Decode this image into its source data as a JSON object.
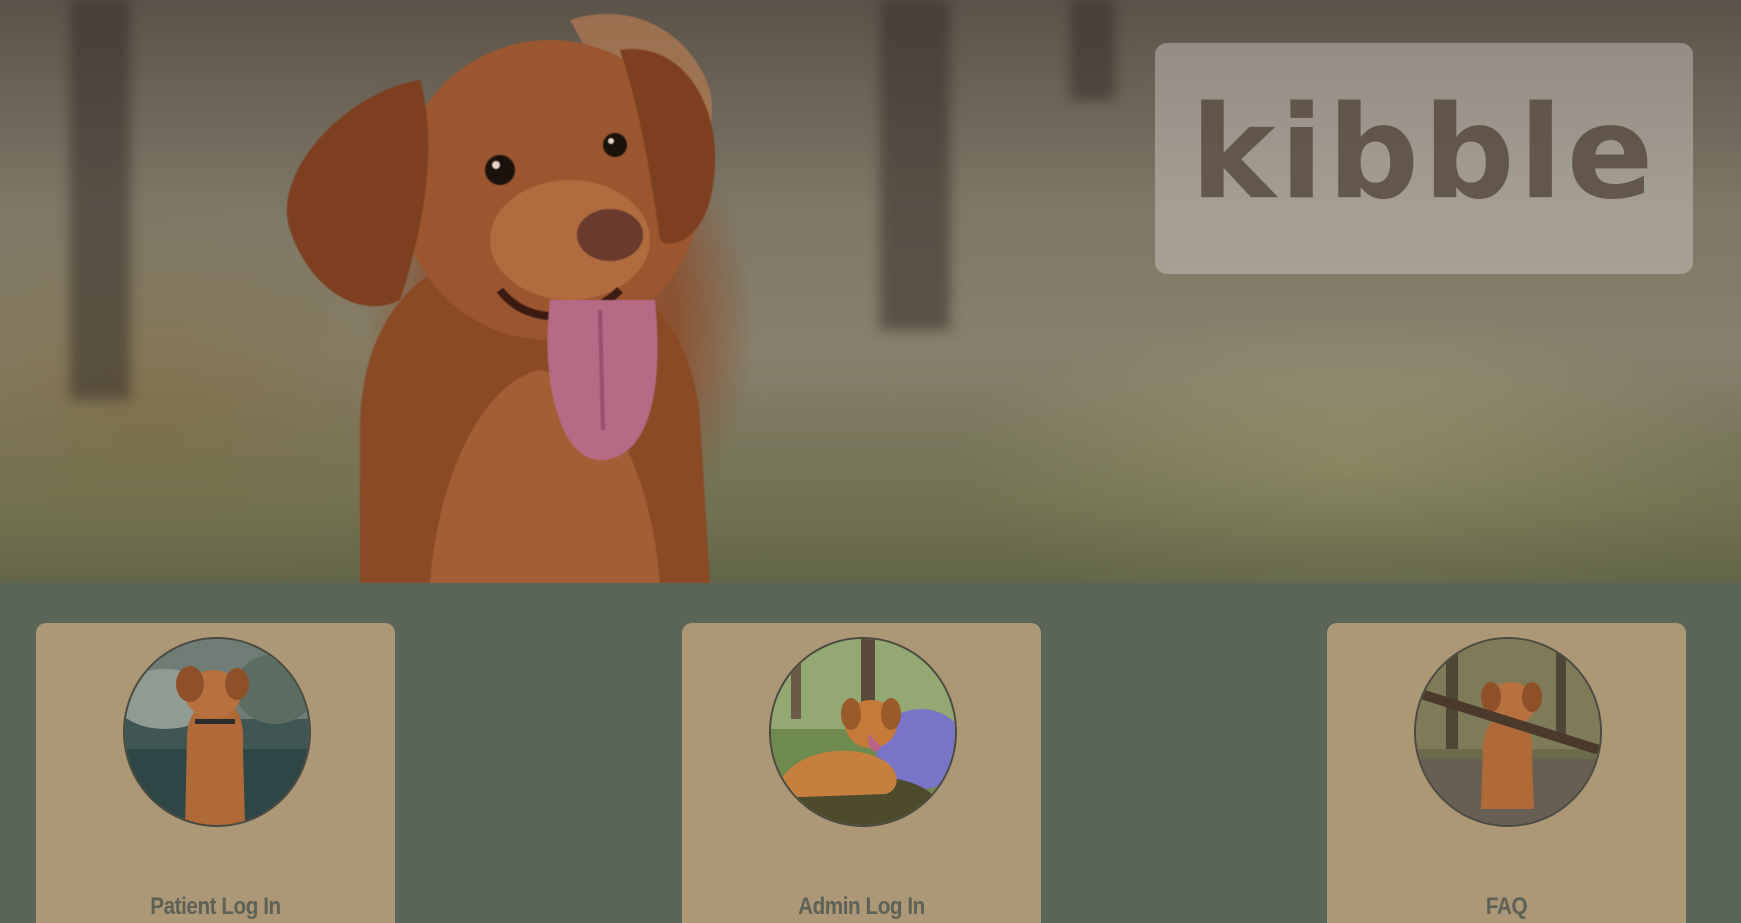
{
  "hero": {
    "logo_text": "kibble"
  },
  "cards": [
    {
      "label": "Patient Log In",
      "icon": "dog-standing-in-water-photo"
    },
    {
      "label": "Admin Log In",
      "icon": "dog-lying-on-rock-photo"
    },
    {
      "label": "FAQ",
      "icon": "dog-with-stick-photo"
    }
  ],
  "colors": {
    "background": "#5a6457",
    "card": "#ac9777",
    "card_text": "#5d6156",
    "logo_text": "#55483e"
  }
}
